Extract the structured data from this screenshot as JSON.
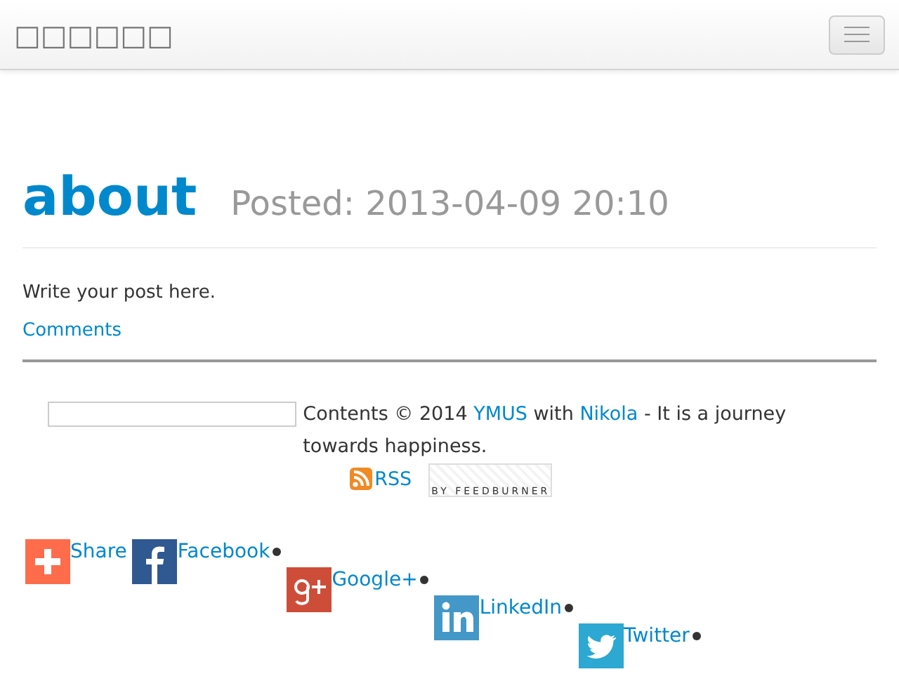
{
  "navbar": {
    "brand": "□□□□□□"
  },
  "post": {
    "title": "about",
    "posted": "Posted: 2013-04-09 20:10",
    "body": "Write your post here.",
    "comments_link": "Comments"
  },
  "footer": {
    "parts": [
      {
        "kind": "text",
        "text": "Contents © 2014 "
      },
      {
        "kind": "link",
        "text": "YMUS"
      },
      {
        "kind": "text",
        "text": " with "
      },
      {
        "kind": "link",
        "text": "Nikola"
      },
      {
        "kind": "text",
        "text": " - It is a journey towards happiness."
      }
    ],
    "rss": "RSS",
    "feedburner": "BY FEEDBURNER"
  },
  "share": [
    {
      "kind": "share",
      "label": "Share",
      "color": "#ff6c4c"
    },
    {
      "kind": "facebook",
      "label": "Facebook",
      "color": "#305891"
    },
    {
      "kind": "google",
      "label": "Google+",
      "color": "#ce4d39"
    },
    {
      "kind": "linkedin",
      "label": "LinkedIn",
      "color": "#4498c8"
    },
    {
      "kind": "twitter",
      "label": "Twitter",
      "color": "#2ca8d2"
    }
  ]
}
